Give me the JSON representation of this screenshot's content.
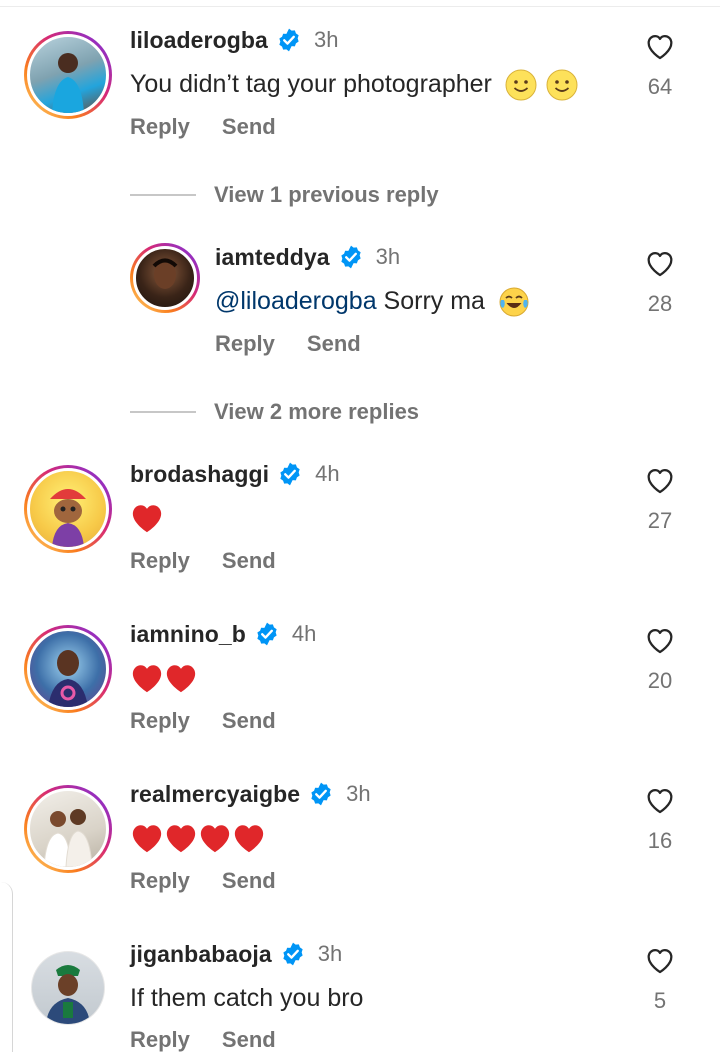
{
  "comments": [
    {
      "username": "liloaderogba",
      "time": "3h",
      "text": "You didn’t tag your photographer",
      "likes": "64"
    },
    {
      "username": "iamteddya",
      "time": "3h",
      "mention": "@liloaderogba",
      "text": " Sorry ma",
      "likes": "28"
    },
    {
      "username": "brodashaggi",
      "time": "4h",
      "likes": "27"
    },
    {
      "username": "iamnino_b",
      "time": "4h",
      "likes": "20"
    },
    {
      "username": "realmercyaigbe",
      "time": "3h",
      "likes": "16"
    },
    {
      "username": "jiganbabaoja",
      "time": "3h",
      "text": "If them catch you bro",
      "likes": "5"
    }
  ],
  "actions": {
    "reply": "Reply",
    "send": "Send"
  },
  "view_previous": "View 1 previous reply",
  "view_more": "View 2 more replies",
  "icons": {
    "verified": "verified-badge-icon",
    "like": "heart-outline-icon",
    "smile": "slightly-smiling-face-emoji",
    "laugh": "tears-of-joy-emoji",
    "heart": "red-heart-emoji"
  },
  "colors": {
    "verified": "#0095f6",
    "mention": "#00376b",
    "muted": "#737373",
    "heart": "#e0272a"
  }
}
